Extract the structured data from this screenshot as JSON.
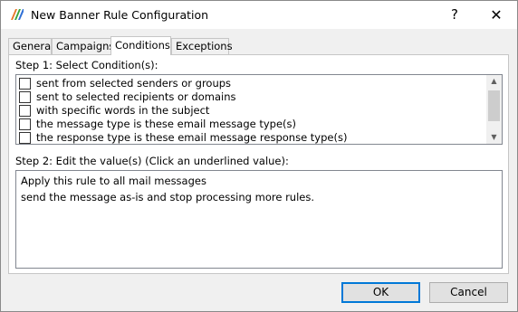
{
  "window": {
    "title": "New Banner Rule Configuration",
    "help_glyph": "?",
    "close_glyph": "✕"
  },
  "tabs": [
    {
      "label": "General"
    },
    {
      "label": "Campaigns"
    },
    {
      "label": "Conditions",
      "active": true
    },
    {
      "label": "Exceptions"
    }
  ],
  "step1": {
    "label": "Step 1: Select Condition(s):",
    "conditions": [
      {
        "label": "sent from selected senders or groups",
        "checked": false
      },
      {
        "label": "sent to selected recipients or domains",
        "checked": false
      },
      {
        "label": "with specific words in the subject",
        "checked": false
      },
      {
        "label": "the message type is these email message type(s)",
        "checked": false
      },
      {
        "label": "the response type is these email message response type(s)",
        "checked": false
      }
    ],
    "scroll_up_glyph": "▲",
    "scroll_down_glyph": "▼"
  },
  "step2": {
    "label": "Step 2: Edit the value(s) (Click an underlined value):",
    "lines": [
      "Apply this rule to all mail messages",
      "send the message as-is and stop processing more rules."
    ]
  },
  "buttons": {
    "ok": "OK",
    "cancel": "Cancel"
  },
  "colors": {
    "focus_border": "#0078d7",
    "dialog_bg": "#f0f0f0"
  }
}
